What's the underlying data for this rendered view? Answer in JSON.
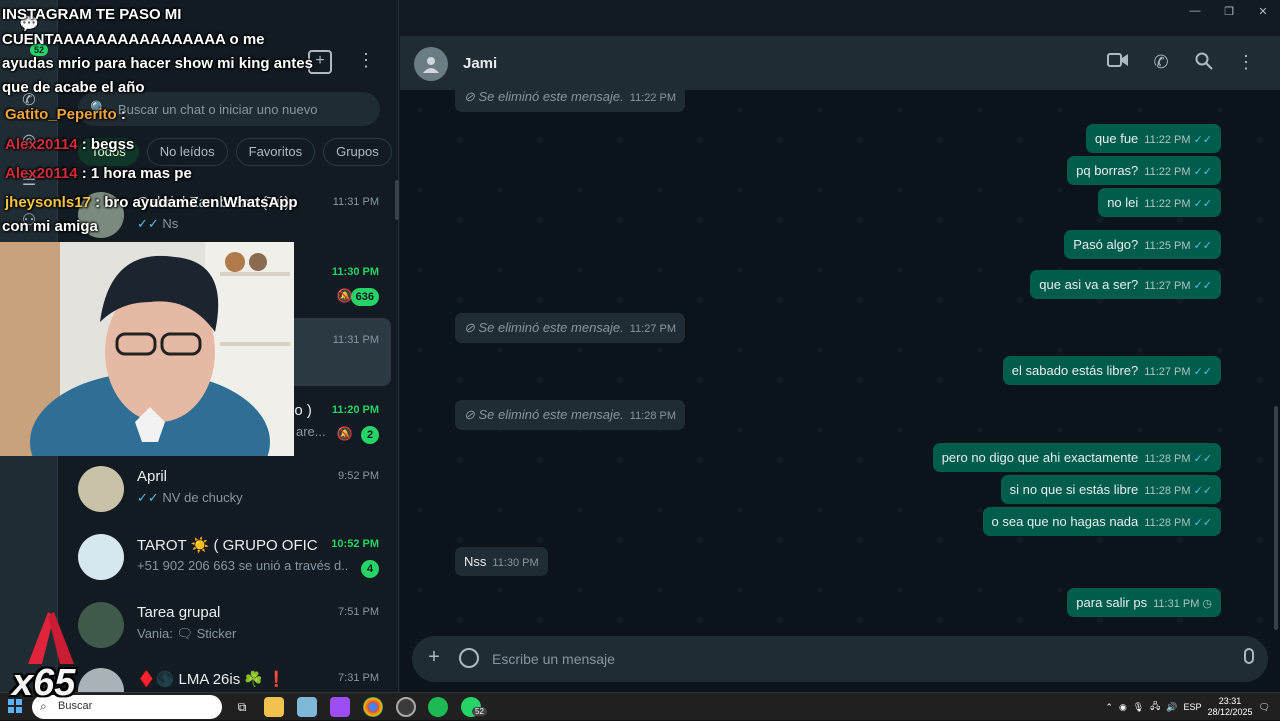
{
  "window": {
    "minimize": "—",
    "restore": "❐",
    "close": "✕"
  },
  "rail": {
    "badge": "52"
  },
  "list": {
    "search_placeholder": "Buscar un chat o iniciar uno nuevo",
    "filters": [
      "Todos",
      "No leídos",
      "Favoritos",
      "Grupos"
    ],
    "chats": [
      {
        "name": "Gabriel Zambrano (Tú)",
        "preview": "Ns",
        "time": "11:31 PM",
        "ticks": "✓✓"
      },
      {
        "name": "",
        "preview": "",
        "time": "11:30 PM",
        "badge": "636",
        "muted": true
      },
      {
        "name": "",
        "preview": "",
        "time": "11:31 PM"
      },
      {
        "name": "po )",
        "preview": "are...",
        "time": "11:20 PM",
        "badge": "2",
        "muted": true
      },
      {
        "name": "April",
        "preview": "NV de chucky",
        "time": "9:52 PM",
        "ticks": "✓✓"
      },
      {
        "name": "TAROT ☀️ ( GRUPO OFICI...",
        "preview": "+51 902 206 663 se unió a través d...",
        "time": "10:52 PM",
        "badge": "4"
      },
      {
        "name": "Tarea grupal",
        "preview": "Vania: 🗨 Sticker",
        "time": "7:51 PM"
      },
      {
        "name": "♦️🌑 LMA 26is ☘️ ❗",
        "preview": "",
        "time": "7:31 PM"
      }
    ]
  },
  "overlay": {
    "line1": "INSTAGRAM TE PASO MI",
    "line2": "CUENTAAAAAAAAAAAAAAAA o me",
    "line3": "ayudas mrio para hacer show mi king antes",
    "line4": "que de acabe el año",
    "chat": [
      {
        "user": "Gatito_Peperito",
        "msg": ":"
      },
      {
        "user": "Alex20114",
        "msg": ": begss"
      },
      {
        "user": "Alex20114",
        "msg": ": 1 hora mas pe"
      },
      {
        "user": "jheysonls17",
        "msg": ": bro ayudame en WhatsApp"
      }
    ],
    "chat_cont": "con mi amiga",
    "multiplier": "x65"
  },
  "conversation": {
    "contact": "Jami",
    "messages": [
      {
        "dir": "in",
        "deleted": true,
        "text": "Se eliminó este mensaje.",
        "time": "11:22 PM"
      },
      {
        "dir": "out",
        "text": "que fue",
        "time": "11:22 PM"
      },
      {
        "dir": "out",
        "text": "pq borras?",
        "time": "11:22 PM"
      },
      {
        "dir": "out",
        "text": "no lei",
        "time": "11:22 PM"
      },
      {
        "dir": "out",
        "text": "Pasó algo?",
        "time": "11:25 PM"
      },
      {
        "dir": "out",
        "text": "que asi va a ser?",
        "time": "11:27 PM"
      },
      {
        "dir": "in",
        "deleted": true,
        "text": "Se eliminó este mensaje.",
        "time": "11:27 PM"
      },
      {
        "dir": "out",
        "text": "el sabado estás libre?",
        "time": "11:27 PM"
      },
      {
        "dir": "in",
        "deleted": true,
        "text": "Se eliminó este mensaje.",
        "time": "11:28 PM"
      },
      {
        "dir": "out",
        "text": "pero no digo que ahi exactamente",
        "time": "11:28 PM"
      },
      {
        "dir": "out",
        "text": "si no que si estás libre",
        "time": "11:28 PM"
      },
      {
        "dir": "out",
        "text": "o sea que no hagas nada",
        "time": "11:28 PM"
      },
      {
        "dir": "in",
        "text": "Nss",
        "time": "11:30 PM"
      },
      {
        "dir": "out",
        "text": "para salir ps",
        "time": "11:31 PM",
        "pending": true
      }
    ],
    "composer_placeholder": "Escribe un mensaje"
  },
  "taskbar": {
    "search_label": "Buscar",
    "whatsapp_badge": "52",
    "lang": "ESP",
    "time": "23:31",
    "date": "28/12/2025"
  }
}
